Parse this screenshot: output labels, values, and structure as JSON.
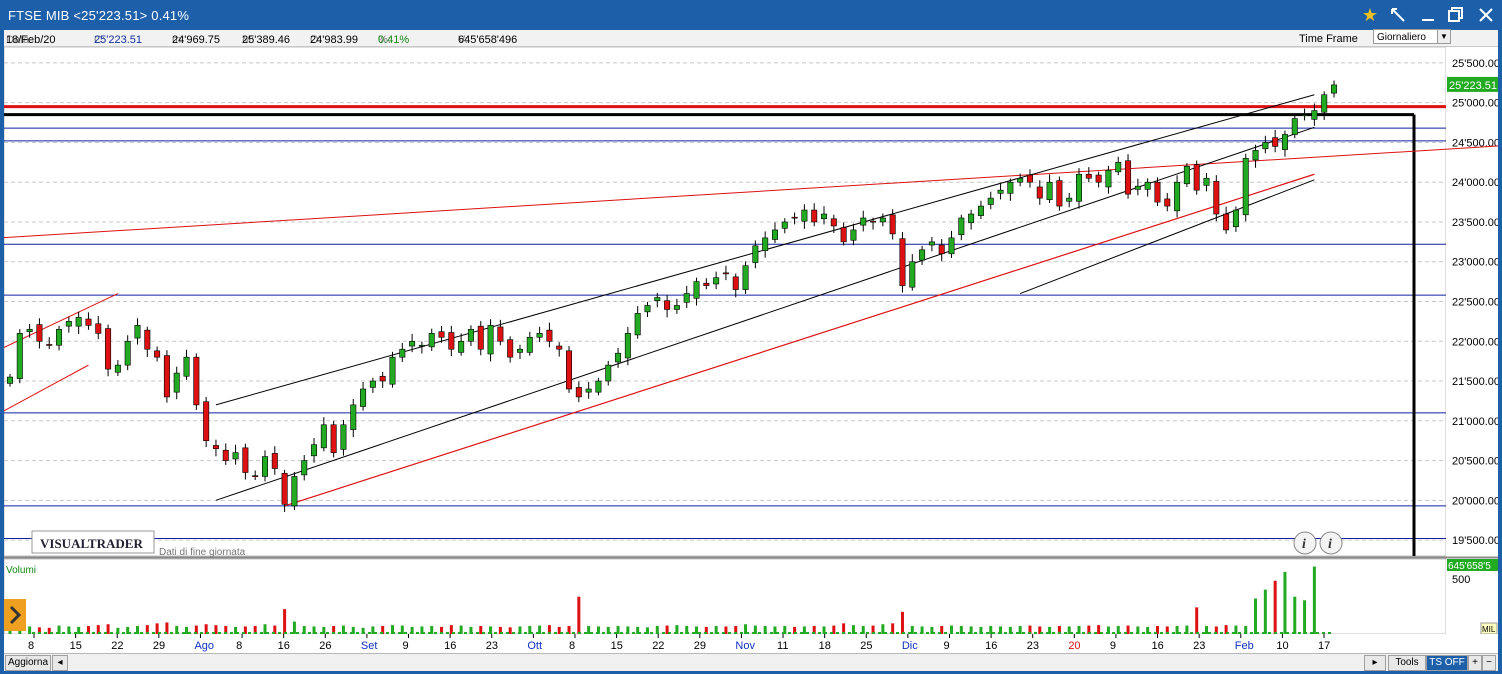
{
  "window": {
    "title": "FTSE MIB <25'223.51> 0.41%",
    "buttons": [
      "star-icon",
      "pin-icon",
      "minimize-icon",
      "maximize-icon",
      "close-icon"
    ],
    "star_color": "#f0c020"
  },
  "info": {
    "data_label": "Data:",
    "data_value": "18/Feb/20",
    "c_label": "C:",
    "c_value": "25'223.51",
    "m_label": "m:",
    "m_value": "24'969.75",
    "M_label": "M:",
    "M_value": "25'389.46",
    "o_label": "O:",
    "o_value": "24'983.99",
    "pct_label": "%:",
    "pct_value": "0.41%",
    "v_label": "V:",
    "v_value": "645'658'496"
  },
  "timeframe": {
    "label": "Time Frame",
    "value": "Giornaliero"
  },
  "logo": {
    "text": "VISUALTRADER",
    "subtitle": "Dati di fine giornata"
  },
  "price_axis": {
    "ticks": [
      "25'500.00",
      "25'000.00",
      "24'500.00",
      "24'000.00",
      "23'500.00",
      "23'000.00",
      "22'500.00",
      "22'000.00",
      "21'500.00",
      "21'000.00",
      "20'500.00",
      "20'000.00",
      "19'500.00"
    ],
    "last_price_label": "25'223.51"
  },
  "volume_panel": {
    "title": "Volumi",
    "axis_tick": "500",
    "unit": "MIL",
    "last_label": "645'658'5"
  },
  "bottom": {
    "update_label": "Aggiorna",
    "tools_label": "Tools",
    "ts_label": "TS OFF",
    "plus": "+",
    "minus": "−"
  },
  "x_axis_labels": [
    {
      "t": "8",
      "blue": false
    },
    {
      "t": "15",
      "blue": false
    },
    {
      "t": "22",
      "blue": false
    },
    {
      "t": "29",
      "blue": false
    },
    {
      "t": "Ago",
      "blue": true
    },
    {
      "t": "8",
      "blue": false
    },
    {
      "t": "16",
      "blue": false
    },
    {
      "t": "26",
      "blue": false
    },
    {
      "t": "Set",
      "blue": true
    },
    {
      "t": "9",
      "blue": false
    },
    {
      "t": "16",
      "blue": false
    },
    {
      "t": "23",
      "blue": false
    },
    {
      "t": "Ott",
      "blue": true
    },
    {
      "t": "8",
      "blue": false
    },
    {
      "t": "15",
      "blue": false
    },
    {
      "t": "22",
      "blue": false
    },
    {
      "t": "29",
      "blue": false
    },
    {
      "t": "Nov",
      "blue": true
    },
    {
      "t": "11",
      "blue": false
    },
    {
      "t": "18",
      "blue": false
    },
    {
      "t": "25",
      "blue": false
    },
    {
      "t": "Dic",
      "blue": true
    },
    {
      "t": "9",
      "blue": false
    },
    {
      "t": "16",
      "blue": false
    },
    {
      "t": "23",
      "blue": false
    },
    {
      "t": "20",
      "blue": false,
      "red": true
    },
    {
      "t": "9",
      "blue": false
    },
    {
      "t": "16",
      "blue": false
    },
    {
      "t": "23",
      "blue": false
    },
    {
      "t": "Feb",
      "blue": true
    },
    {
      "t": "10",
      "blue": false
    },
    {
      "t": "17",
      "blue": false
    }
  ],
  "chart_data": {
    "type": "candlestick",
    "title": "FTSE MIB",
    "ylim": [
      19300,
      25700
    ],
    "up_color": "#22aa22",
    "down_color": "#dd1111",
    "horizontal_lines": [
      {
        "y": 24950,
        "color": "#dd1111"
      },
      {
        "y": 24850,
        "color": "#000000"
      },
      {
        "y": 24680,
        "color": "#1020a0"
      },
      {
        "y": 24520,
        "color": "#1020a0"
      },
      {
        "y": 23220,
        "color": "#1020a0"
      },
      {
        "y": 22580,
        "color": "#1020a0"
      },
      {
        "y": 21100,
        "color": "#1020a0"
      },
      {
        "y": 19930,
        "color": "#1020a0"
      },
      {
        "y": 19520,
        "color": "#1020a0"
      }
    ],
    "closes": [
      21550,
      22100,
      22150,
      22000,
      21950,
      22150,
      22250,
      22300,
      22200,
      22100,
      21650,
      21700,
      22000,
      22200,
      21900,
      21800,
      21300,
      21600,
      21800,
      21200,
      20750,
      20650,
      20500,
      20600,
      20350,
      20300,
      20550,
      20400,
      19950,
      20300,
      20500,
      20700,
      20950,
      20600,
      20950,
      21200,
      21400,
      21500,
      21500,
      21800,
      21900,
      22000,
      21950,
      22100,
      22050,
      21900,
      22000,
      22150,
      21900,
      22200,
      22000,
      21800,
      21900,
      22050,
      22100,
      22000,
      21900,
      21400,
      21300,
      21400,
      21500,
      21700,
      21850,
      22100,
      22350,
      22450,
      22550,
      22400,
      22450,
      22600,
      22750,
      22700,
      22800,
      22850,
      22650,
      22950,
      23200,
      23300,
      23400,
      23500,
      23550,
      23650,
      23500,
      23600,
      23450,
      23250,
      23400,
      23550,
      23500,
      23550,
      23350,
      22700,
      23000,
      23150,
      23250,
      23100,
      23300,
      23550,
      23600,
      23700,
      23800,
      23900,
      24000,
      24050,
      24000,
      23800,
      24000,
      23700,
      23800,
      24100,
      24050,
      24000,
      24150,
      24250,
      23850,
      23950,
      24000,
      23750,
      23700,
      24000,
      24200,
      23900,
      24050,
      23600,
      23400,
      23650,
      24300,
      24400,
      24500,
      24450,
      24600,
      24800,
      24850,
      24900,
      25100,
      25223.51
    ],
    "volumes": [
      80,
      90,
      85,
      75,
      70,
      95,
      85,
      80,
      90,
      100,
      110,
      70,
      80,
      90,
      100,
      120,
      130,
      90,
      80,
      95,
      110,
      100,
      90,
      80,
      85,
      90,
      110,
      95,
      280,
      140,
      90,
      85,
      80,
      90,
      95,
      80,
      70,
      85,
      90,
      100,
      95,
      80,
      85,
      90,
      80,
      100,
      95,
      80,
      90,
      85,
      80,
      75,
      85,
      90,
      95,
      100,
      80,
      90,
      420,
      90,
      85,
      80,
      90,
      85,
      80,
      75,
      90,
      95,
      100,
      90,
      85,
      80,
      90,
      85,
      90,
      110,
      95,
      90,
      85,
      90,
      80,
      85,
      90,
      85,
      95,
      120,
      100,
      90,
      95,
      110,
      120,
      250,
      90,
      85,
      80,
      90,
      95,
      90,
      85,
      80,
      90,
      85,
      80,
      90,
      95,
      85,
      80,
      90,
      85,
      90,
      95,
      100,
      85,
      90,
      95,
      85,
      80,
      90,
      85,
      90,
      95,
      300,
      90,
      85,
      100,
      95,
      90,
      400,
      500,
      600,
      700,
      420,
      380,
      760
    ]
  }
}
